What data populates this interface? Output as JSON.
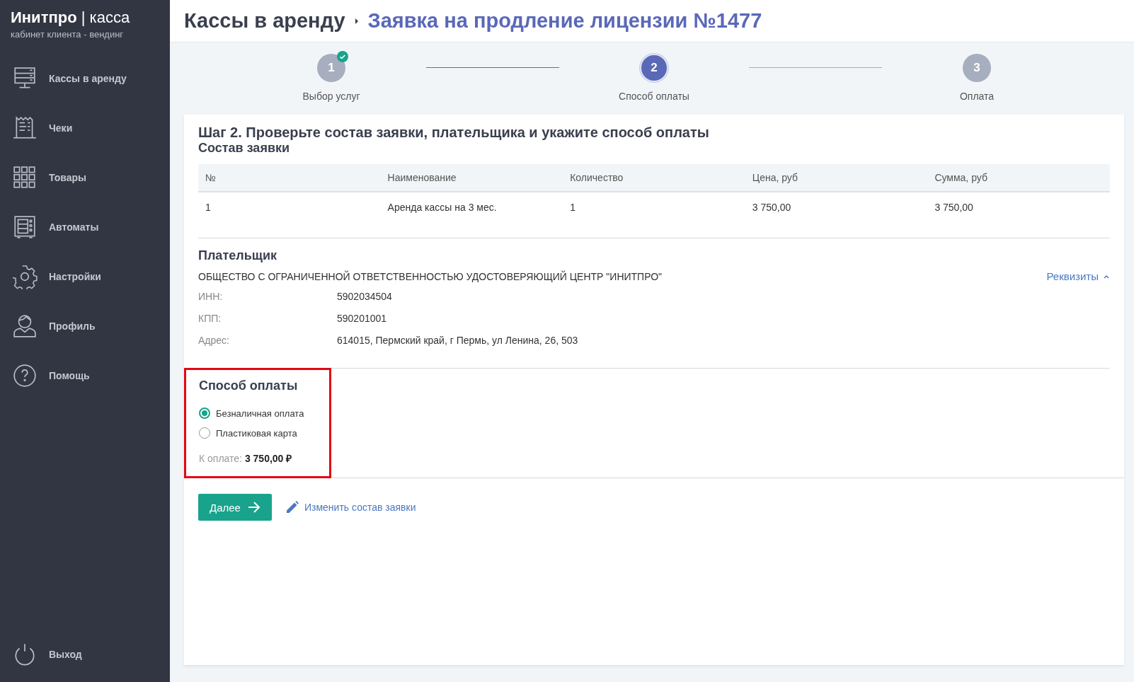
{
  "sidebar": {
    "brand": "Инитпро",
    "brand_separator": "|",
    "brand_suffix": "касса",
    "subtitle": "кабинет клиента - вендинг",
    "items": [
      {
        "label": "Кассы в аренду"
      },
      {
        "label": "Чеки"
      },
      {
        "label": "Товары"
      },
      {
        "label": "Автоматы"
      },
      {
        "label": "Настройки"
      },
      {
        "label": "Профиль"
      },
      {
        "label": "Помощь"
      }
    ],
    "logout": "Выход"
  },
  "breadcrumb": {
    "parent": "Кассы в аренду",
    "current": "Заявка на продление лицензии №1477"
  },
  "steps": [
    {
      "number": "1",
      "label": "Выбор услуг",
      "completed": true,
      "selected": false
    },
    {
      "number": "2",
      "label": "Способ оплаты",
      "completed": false,
      "selected": true
    },
    {
      "number": "3",
      "label": "Оплата",
      "completed": false,
      "selected": false
    }
  ],
  "heading": "Шаг 2. Проверьте состав заявки, плательщика и укажите способ оплаты",
  "order": {
    "title": "Состав заявки",
    "columns": [
      "№",
      "Наименование",
      "Количество",
      "Цена, руб",
      "Сумма, руб"
    ],
    "rows": [
      [
        "1",
        "Аренда кассы на 3 мес.",
        "1",
        "3 750,00",
        "3 750,00"
      ]
    ]
  },
  "payer": {
    "title": "Плательщик",
    "name": "ОБЩЕСТВО С ОГРАНИЧЕННОЙ ОТВЕТСТВЕННОСТЬЮ УДОСТОВЕРЯЮЩИЙ ЦЕНТР \"ИНИТПРО\"",
    "details_link": "Реквизиты",
    "details_expanded": true,
    "fields": [
      {
        "label": "ИНН:",
        "value": "5902034504"
      },
      {
        "label": "КПП:",
        "value": "590201001"
      },
      {
        "label": "Адрес:",
        "value": "614015, Пермский край, г Пермь, ул Ленина, 26, 503"
      }
    ]
  },
  "payment": {
    "title": "Способ оплаты",
    "highlighted": true,
    "options": [
      {
        "label": "Безналичная оплата",
        "selected": true
      },
      {
        "label": "Пластиковая карта",
        "selected": false
      }
    ],
    "total_label": "К оплате:",
    "total": "3 750,00 ₽"
  },
  "actions": {
    "next": "Далее",
    "edit": "Изменить состав заявки"
  }
}
